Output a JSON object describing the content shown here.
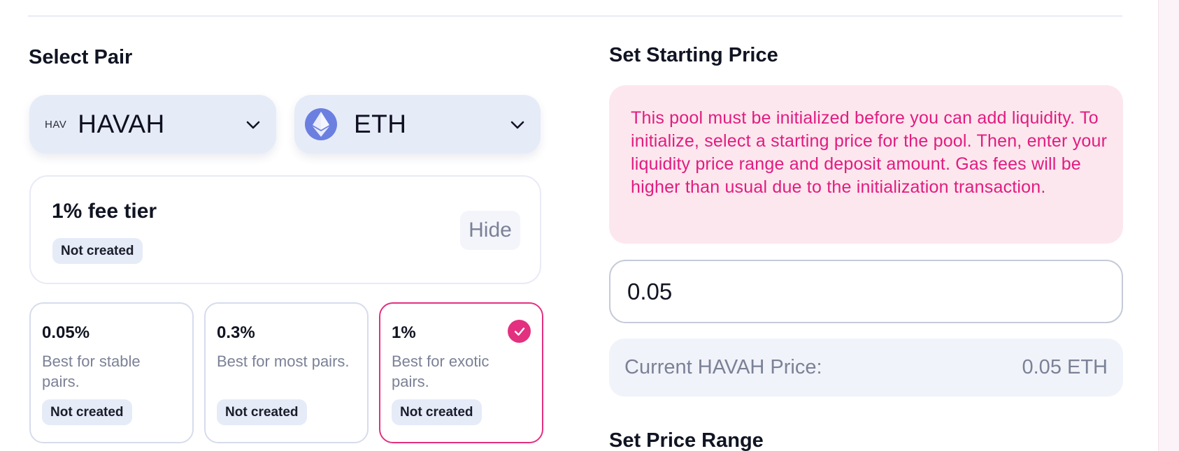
{
  "select_pair": {
    "title": "Select Pair",
    "token_a": {
      "logo_text": "HAV",
      "symbol": "HAVAH",
      "icon": "chevron-down-icon"
    },
    "token_b": {
      "logo_icon": "eth-logo-icon",
      "symbol": "ETH",
      "icon": "chevron-down-icon"
    }
  },
  "fee_summary": {
    "title": "1% fee tier",
    "status": "Not created",
    "toggle_label": "Hide"
  },
  "fee_tiers": [
    {
      "pct": "0.05%",
      "desc": "Best for stable pairs.",
      "status": "Not created",
      "selected": false
    },
    {
      "pct": "0.3%",
      "desc": "Best for most pairs.",
      "status": "Not created",
      "selected": false
    },
    {
      "pct": "1%",
      "desc": "Best for exotic pairs.",
      "status": "Not created",
      "selected": true
    }
  ],
  "starting_price": {
    "title": "Set Starting Price",
    "notice": "This pool must be initialized before you can add liquidity. To initialize, select a starting price for the pool. Then, enter your liquidity price range and deposit amount. Gas fees will be higher than usual due to the initialization transaction.",
    "input_value": "0.05",
    "current_label": "Current HAVAH Price:",
    "current_value": "0.05 ETH"
  },
  "price_range": {
    "title": "Set Price Range"
  },
  "colors": {
    "accent": "#e3307f",
    "notice_bg": "#fde7ee",
    "notice_text": "#e11c80",
    "selector_bg": "#e6ebf8",
    "eth": "#6a7fe0"
  }
}
